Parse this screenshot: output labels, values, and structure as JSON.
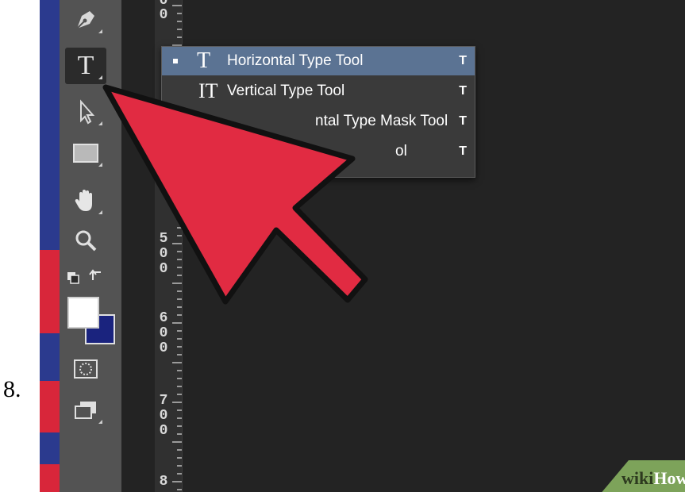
{
  "step_number": "8.",
  "toolbar": {
    "tools": [
      {
        "name": "pen-tool",
        "icon": "pen-icon"
      },
      {
        "name": "type-tool",
        "icon": "type-icon",
        "glyph": "T",
        "active": true
      },
      {
        "name": "path-selection-tool",
        "icon": "arrow-select-icon"
      },
      {
        "name": "rectangle-tool",
        "icon": "rectangle-icon"
      },
      {
        "name": "hand-tool",
        "icon": "hand-icon"
      },
      {
        "name": "zoom-tool",
        "icon": "magnifier-icon"
      },
      {
        "name": "default-colors",
        "icon": "swap-colors-icon"
      },
      {
        "name": "color-swatches",
        "icon": "foreground-background-icon",
        "foreground": "#ffffff",
        "background": "#1a237e"
      },
      {
        "name": "quick-mask",
        "icon": "quick-mask-icon"
      },
      {
        "name": "screen-mode",
        "icon": "screen-mode-icon"
      }
    ]
  },
  "ruler": {
    "digits": [
      "0",
      "5",
      "0",
      "0",
      "6",
      "0",
      "0",
      "7",
      "0",
      "0",
      "8"
    ]
  },
  "flyout_menu": {
    "items": [
      {
        "icon": "T",
        "label": "Horizontal Type Tool",
        "shortcut": "T",
        "selected": true
      },
      {
        "icon": "IT",
        "label": "Vertical Type Tool",
        "shortcut": "T",
        "selected": false
      },
      {
        "icon": "",
        "label": "ntal Type Mask Tool",
        "shortcut": "T",
        "selected": false
      },
      {
        "icon": "",
        "label": "ol",
        "shortcut": "T",
        "selected": false
      }
    ]
  },
  "watermark": {
    "part1": "wiki",
    "part2": "How"
  },
  "colors": {
    "arrow_fill": "#e12b42",
    "menu_highlight": "#5b7393",
    "toolbar": "#535353",
    "canvas": "#232323",
    "badge": "#7da35a"
  }
}
